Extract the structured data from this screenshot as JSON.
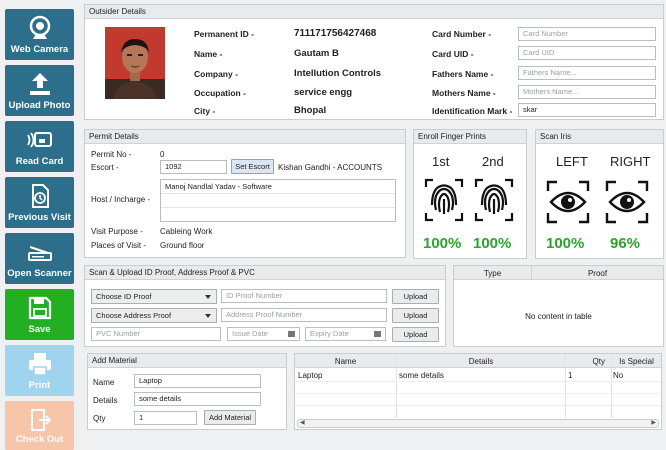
{
  "sidebar": [
    {
      "label": "Web Camera",
      "icon": "webcam-icon"
    },
    {
      "label": "Upload Photo",
      "icon": "upload-icon"
    },
    {
      "label": "Read Card",
      "icon": "card-reader-icon"
    },
    {
      "label": "Previous Visit",
      "icon": "previous-visit-icon"
    },
    {
      "label": "Open Scanner",
      "icon": "scanner-icon"
    },
    {
      "label": "Save",
      "icon": "floppy-disk-icon"
    },
    {
      "label": "Print",
      "icon": "printer-icon"
    },
    {
      "label": "Check Out",
      "icon": "exit-door-icon"
    }
  ],
  "outsider": {
    "title": "Outsider Details",
    "permanent_id_label": "Permanent ID -",
    "permanent_id": "711171756427468",
    "name_label": "Name -",
    "name": "Gautam B",
    "company_label": "Company -",
    "company": "Intellution Controls",
    "occupation_label": "Occupation -",
    "occupation": "service engg",
    "city_label": "City -",
    "city": "Bhopal",
    "card_number_label": "Card Number -",
    "card_number_placeholder": "Card Number",
    "card_uid_label": "Card UID -",
    "card_uid_placeholder": "Card UID",
    "fathers_name_label": "Fathers Name -",
    "fathers_name_placeholder": "Fathers Name...",
    "mothers_name_label": "Mothers Name -",
    "mothers_name_placeholder": "Mothers Name...",
    "identification_mark_label": "Identification Mark -",
    "identification_mark": "skar"
  },
  "permit": {
    "title": "Permit Details",
    "permit_no_label": "Permit No -",
    "permit_no": "0",
    "escort_label": "Escort -",
    "escort_value": "1092",
    "set_escort_button": "Set Escort",
    "escort_name": "Kishan Gandhi - ACCOUNTS",
    "host_label": "Host / Incharge -",
    "host_value": "Manoj Nandlal Yadav - Software",
    "visit_purpose_label": "Visit Purpose -",
    "visit_purpose": "Cableing Work",
    "places_label": "Places of Visit -",
    "places": "Ground floor"
  },
  "finger": {
    "title": "Enroll Finger Prints",
    "first_label": "1st",
    "second_label": "2nd",
    "first_pct": "100%",
    "second_pct": "100%"
  },
  "iris": {
    "title": "Scan Iris",
    "left_label": "LEFT",
    "right_label": "RIGHT",
    "left_pct": "100%",
    "right_pct": "96%"
  },
  "scan": {
    "title": "Scan & Upload ID Proof, Address Proof & PVC",
    "id_proof_select": "Choose ID Proof",
    "id_proof_placeholder": "ID Proof Number",
    "address_select": "Choose Address Proof",
    "address_placeholder": "Address Proof Number",
    "pvc_placeholder": "PVC Number",
    "issue_date_placeholder": "Issue Date",
    "expiry_date_placeholder": "Expiry Date",
    "upload_label": "Upload"
  },
  "proof_table": {
    "columns": [
      "Type",
      "Proof"
    ],
    "empty_text": "No content in table"
  },
  "material": {
    "title": "Add Material",
    "name_label": "Name",
    "name_value": "Laptop",
    "details_label": "Details",
    "details_value": "some details",
    "qty_label": "Qty",
    "qty_value": "1",
    "add_button": "Add Material"
  },
  "material_table": {
    "columns": [
      "Name",
      "Details",
      "Qty",
      "Is Special"
    ],
    "rows": [
      {
        "name": "Laptop",
        "details": "some details",
        "qty": "1",
        "special": "No"
      }
    ]
  },
  "colors": {
    "sidebar_teal": "#2d6e8a",
    "save_green": "#22b022",
    "print_light_blue": "#9fd3ee",
    "checkout_peach": "#f7c6a8",
    "percent_green": "#2aa52a"
  }
}
